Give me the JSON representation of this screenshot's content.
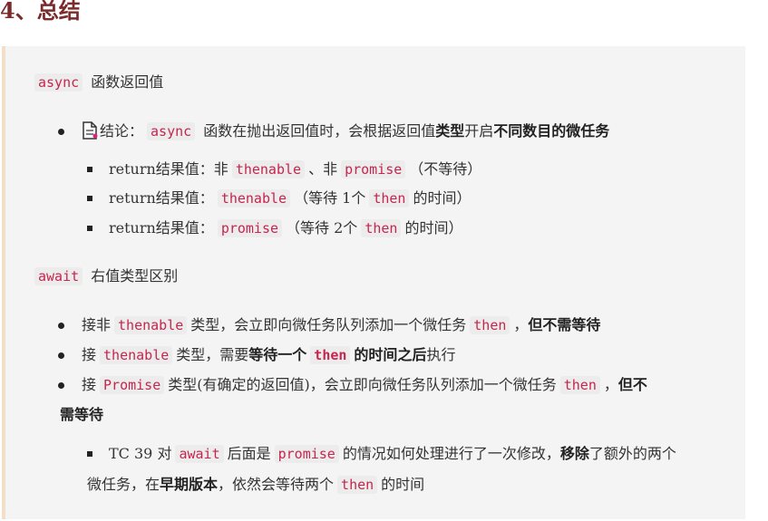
{
  "heading": "4、总结",
  "async_section": {
    "code": "async",
    "title": " 函数返回值",
    "conclusion": {
      "icon": "document-icon",
      "prefix": "结论：",
      "code": "async",
      "text1": " 函数在抛出返回值时，会根据返回值",
      "bold1": "类型",
      "text2": "开启",
      "bold2": "不同数目的微任务"
    },
    "items": [
      {
        "p1": "return结果值：非",
        "c1": "thenable",
        "p2": "、非",
        "c2": "promise",
        "p3": "（不等待）"
      },
      {
        "p1": "return结果值：",
        "c1": "thenable",
        "p2": "（等待 1个",
        "c2": "then",
        "p3": "的时间）"
      },
      {
        "p1": "return结果值：",
        "c1": "promise",
        "p2": "（等待 2个",
        "c2": "then",
        "p3": "的时间）"
      }
    ]
  },
  "await_section": {
    "code": "await",
    "title": " 右值类型区别",
    "b1": {
      "p1": "接非",
      "c1": "thenable",
      "p2": "类型，会立即向微任务队列添加一个微任务",
      "c2": "then",
      "p3": "，",
      "bold": "但不需等待"
    },
    "b2": {
      "p1": "接",
      "c1": "thenable",
      "p2": "类型，需要",
      "bold1": "等待一个",
      "c2": "then",
      "bold2": "的时间之后",
      "p3": "执行"
    },
    "b3": {
      "p1": "接",
      "c1": "Promise",
      "p2": "类型(有确定的返回值)，会立即向微任务队列添加一个微任务",
      "c2": "then",
      "p3": "，",
      "bold_a": "但不",
      "bold_b": "需等待"
    },
    "note": {
      "p1": "TC 39 对",
      "c1": "await",
      "p2": "后面是",
      "c2": "promise",
      "p3": "的情况如何处理进行了一次修改，",
      "bold1": "移除",
      "p4": "了额外的两个",
      "p5": "微任务，在",
      "bold2": "早期版本",
      "p6": "，依然会等待两个",
      "c3": "then",
      "p7": "的时间"
    }
  }
}
